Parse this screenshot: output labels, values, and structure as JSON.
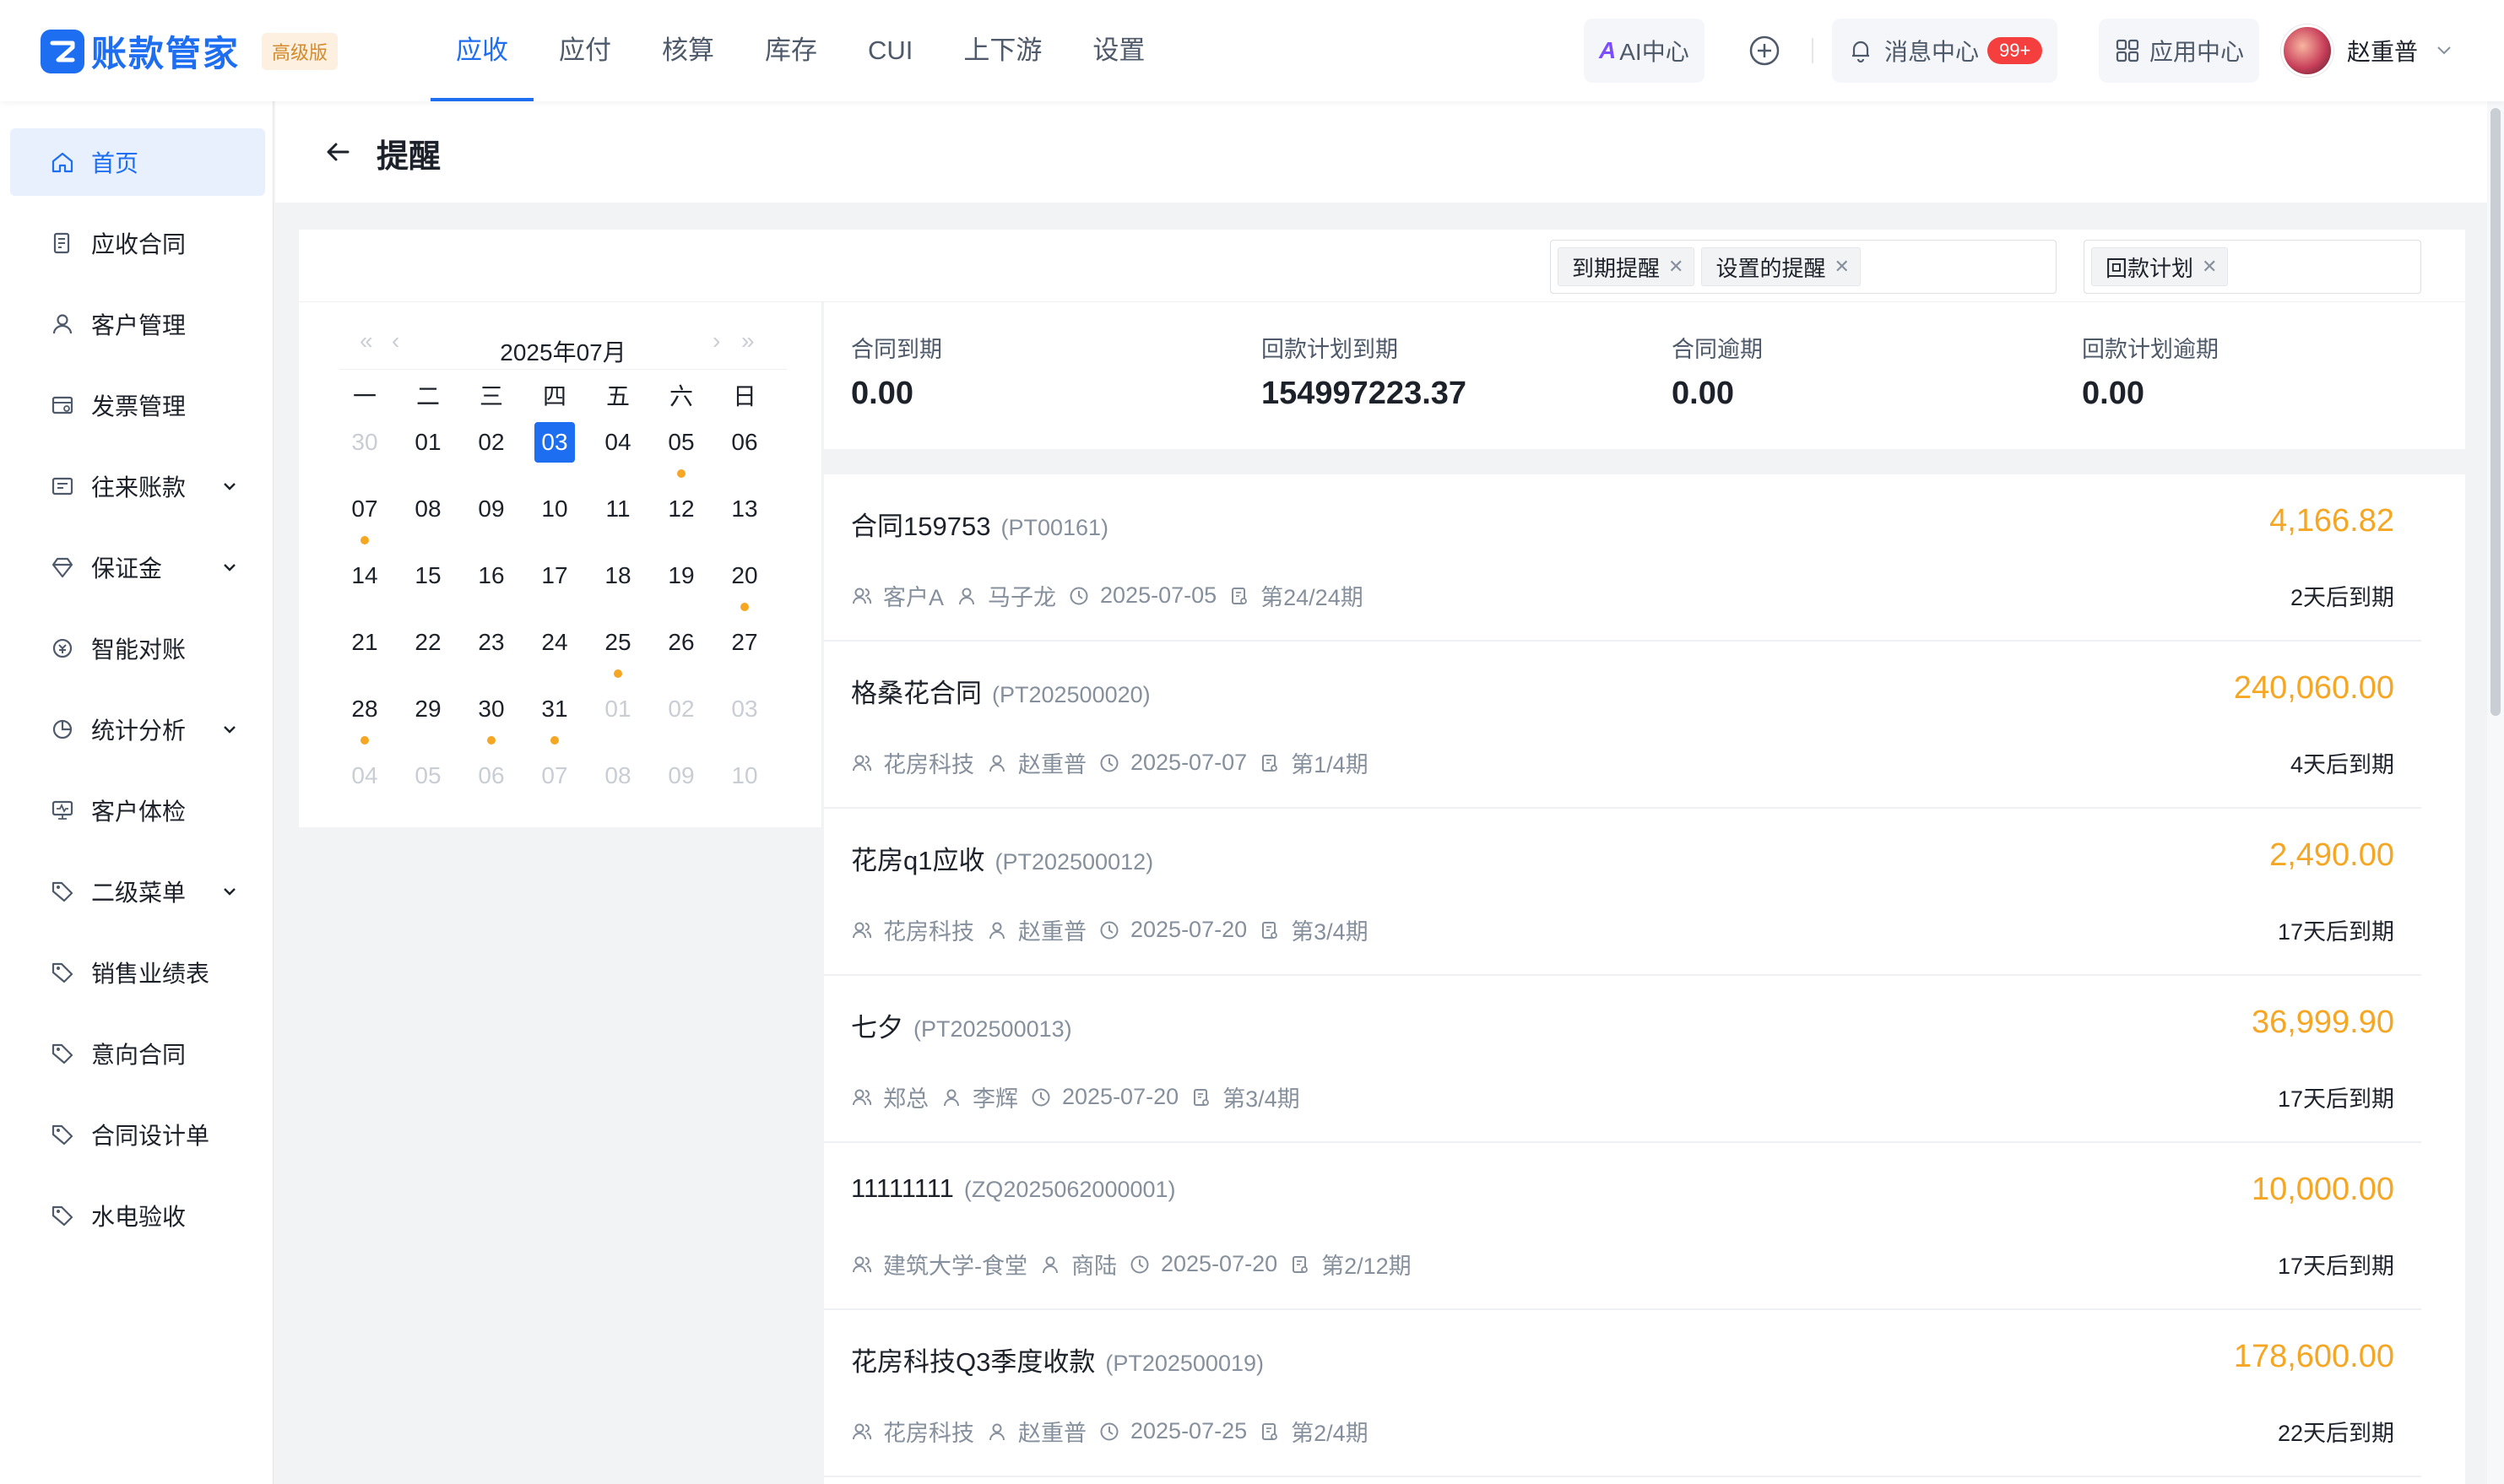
{
  "app": {
    "name": "账款管家",
    "edition": "高级版"
  },
  "topnav": [
    {
      "label": "应收",
      "active": true
    },
    {
      "label": "应付",
      "active": false
    },
    {
      "label": "核算",
      "active": false
    },
    {
      "label": "库存",
      "active": false
    },
    {
      "label": "CUI",
      "active": false
    },
    {
      "label": "上下游",
      "active": false
    },
    {
      "label": "设置",
      "active": false
    }
  ],
  "header_right": {
    "ai_center": "AI中心",
    "message_center": "消息中心",
    "message_count": "99+",
    "app_center": "应用中心",
    "user_name": "赵重普"
  },
  "sidebar": {
    "items": [
      {
        "label": "首页",
        "icon": "home-icon",
        "active": true,
        "expandable": false
      },
      {
        "label": "应收合同",
        "icon": "contract-icon",
        "active": false,
        "expandable": false
      },
      {
        "label": "客户管理",
        "icon": "user-icon",
        "active": false,
        "expandable": false
      },
      {
        "label": "发票管理",
        "icon": "invoice-icon",
        "active": false,
        "expandable": false
      },
      {
        "label": "往来账款",
        "icon": "ledger-icon",
        "active": false,
        "expandable": true
      },
      {
        "label": "保证金",
        "icon": "diamond-icon",
        "active": false,
        "expandable": true
      },
      {
        "label": "智能对账",
        "icon": "reconcile-icon",
        "active": false,
        "expandable": false
      },
      {
        "label": "统计分析",
        "icon": "pie-chart-icon",
        "active": false,
        "expandable": true
      },
      {
        "label": "客户体检",
        "icon": "monitor-icon",
        "active": false,
        "expandable": false
      },
      {
        "label": "二级菜单",
        "icon": "tag-icon",
        "active": false,
        "expandable": true
      },
      {
        "label": "销售业绩表",
        "icon": "tag-icon",
        "active": false,
        "expandable": false
      },
      {
        "label": "意向合同",
        "icon": "tag-icon",
        "active": false,
        "expandable": false
      },
      {
        "label": "合同设计单",
        "icon": "tag-icon",
        "active": false,
        "expandable": false
      },
      {
        "label": "水电验收",
        "icon": "tag-icon",
        "active": false,
        "expandable": false
      }
    ]
  },
  "page": {
    "title": "提醒"
  },
  "filters": {
    "group1": [
      "到期提醒",
      "设置的提醒"
    ],
    "group2": [
      "回款计划"
    ]
  },
  "calendar": {
    "month_label": "2025年07月",
    "weekdays": [
      "一",
      "二",
      "三",
      "四",
      "五",
      "六",
      "日"
    ],
    "weeks": [
      [
        {
          "d": "30",
          "m": true
        },
        {
          "d": "01"
        },
        {
          "d": "02"
        },
        {
          "d": "03",
          "sel": true
        },
        {
          "d": "04"
        },
        {
          "d": "05",
          "dot": true
        },
        {
          "d": "06"
        }
      ],
      [
        {
          "d": "07",
          "dot": true
        },
        {
          "d": "08"
        },
        {
          "d": "09"
        },
        {
          "d": "10"
        },
        {
          "d": "11"
        },
        {
          "d": "12"
        },
        {
          "d": "13"
        }
      ],
      [
        {
          "d": "14"
        },
        {
          "d": "15"
        },
        {
          "d": "16"
        },
        {
          "d": "17"
        },
        {
          "d": "18"
        },
        {
          "d": "19"
        },
        {
          "d": "20",
          "dot": true
        }
      ],
      [
        {
          "d": "21"
        },
        {
          "d": "22"
        },
        {
          "d": "23"
        },
        {
          "d": "24"
        },
        {
          "d": "25",
          "dot": true
        },
        {
          "d": "26"
        },
        {
          "d": "27"
        }
      ],
      [
        {
          "d": "28",
          "dot": true
        },
        {
          "d": "29"
        },
        {
          "d": "30",
          "dot": true
        },
        {
          "d": "31",
          "dot": true
        },
        {
          "d": "01",
          "m": true
        },
        {
          "d": "02",
          "m": true
        },
        {
          "d": "03",
          "m": true
        }
      ],
      [
        {
          "d": "04",
          "m": true
        },
        {
          "d": "05",
          "m": true
        },
        {
          "d": "06",
          "m": true
        },
        {
          "d": "07",
          "m": true
        },
        {
          "d": "08",
          "m": true
        },
        {
          "d": "09",
          "m": true
        },
        {
          "d": "10",
          "m": true
        }
      ]
    ]
  },
  "stats": [
    {
      "label": "合同到期",
      "value": "0.00"
    },
    {
      "label": "回款计划到期",
      "value": "154997223.37"
    },
    {
      "label": "合同逾期",
      "value": "0.00"
    },
    {
      "label": "回款计划逾期",
      "value": "0.00"
    }
  ],
  "reminders": [
    {
      "title": "合同159753",
      "code": "(PT00161)",
      "amount": "4,166.82",
      "customer": "客户A",
      "owner": "马子龙",
      "date": "2025-07-05",
      "period": "第24/24期",
      "due": "2天后到期"
    },
    {
      "title": "格桑花合同",
      "code": "(PT202500020)",
      "amount": "240,060.00",
      "customer": "花房科技",
      "owner": "赵重普",
      "date": "2025-07-07",
      "period": "第1/4期",
      "due": "4天后到期"
    },
    {
      "title": "花房q1应收",
      "code": "(PT202500012)",
      "amount": "2,490.00",
      "customer": "花房科技",
      "owner": "赵重普",
      "date": "2025-07-20",
      "period": "第3/4期",
      "due": "17天后到期"
    },
    {
      "title": "七夕",
      "code": "(PT202500013)",
      "amount": "36,999.90",
      "customer": "郑总",
      "owner": "李辉",
      "date": "2025-07-20",
      "period": "第3/4期",
      "due": "17天后到期"
    },
    {
      "title": "11111111",
      "code": "(ZQ2025062000001)",
      "amount": "10,000.00",
      "customer": "建筑大学-食堂",
      "owner": "商陆",
      "date": "2025-07-20",
      "period": "第2/12期",
      "due": "17天后到期"
    },
    {
      "title": "花房科技Q3季度收款",
      "code": "(PT202500019)",
      "amount": "178,600.00",
      "customer": "花房科技",
      "owner": "赵重普",
      "date": "2025-07-25",
      "period": "第2/4期",
      "due": "22天后到期"
    }
  ],
  "colors": {
    "primary": "#1e6ef2",
    "amount": "#f5a623",
    "badge": "#f53f3f"
  }
}
